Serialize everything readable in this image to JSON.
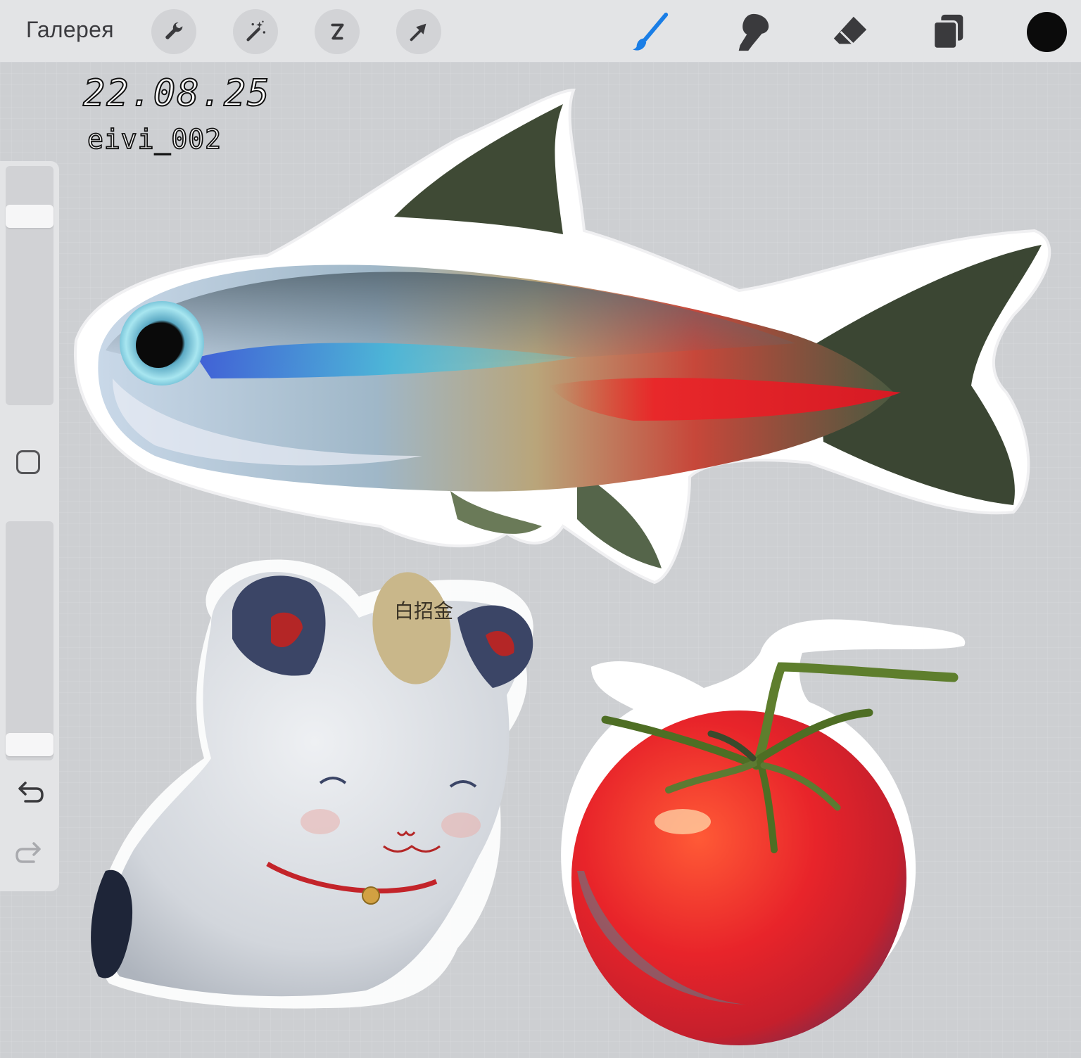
{
  "toolbar": {
    "gallery_label": "Галерея",
    "left_tools": [
      "wrench-icon",
      "magic-wand-icon",
      "selection-icon",
      "transform-arrow-icon"
    ],
    "right_tools": [
      "brush-icon",
      "smudge-icon",
      "eraser-icon",
      "layers-icon"
    ],
    "active_tool": "brush-icon",
    "current_color": "#0b0b0b",
    "accent_color": "#1a7ee6"
  },
  "canvas": {
    "date_text": "22.08.25",
    "signature_text": "eivi_002",
    "subjects": [
      "neon-tetra-fish",
      "maneki-neko-cat",
      "tomato"
    ],
    "cat_tag_text": "白招金"
  },
  "sidebar": {
    "size_slider_label": "Brush size",
    "opacity_slider_label": "Opacity",
    "brush_size": 0.82,
    "opacity": 0.02,
    "modify_button": "square-icon",
    "undo": "undo-icon",
    "redo": "redo-icon"
  }
}
